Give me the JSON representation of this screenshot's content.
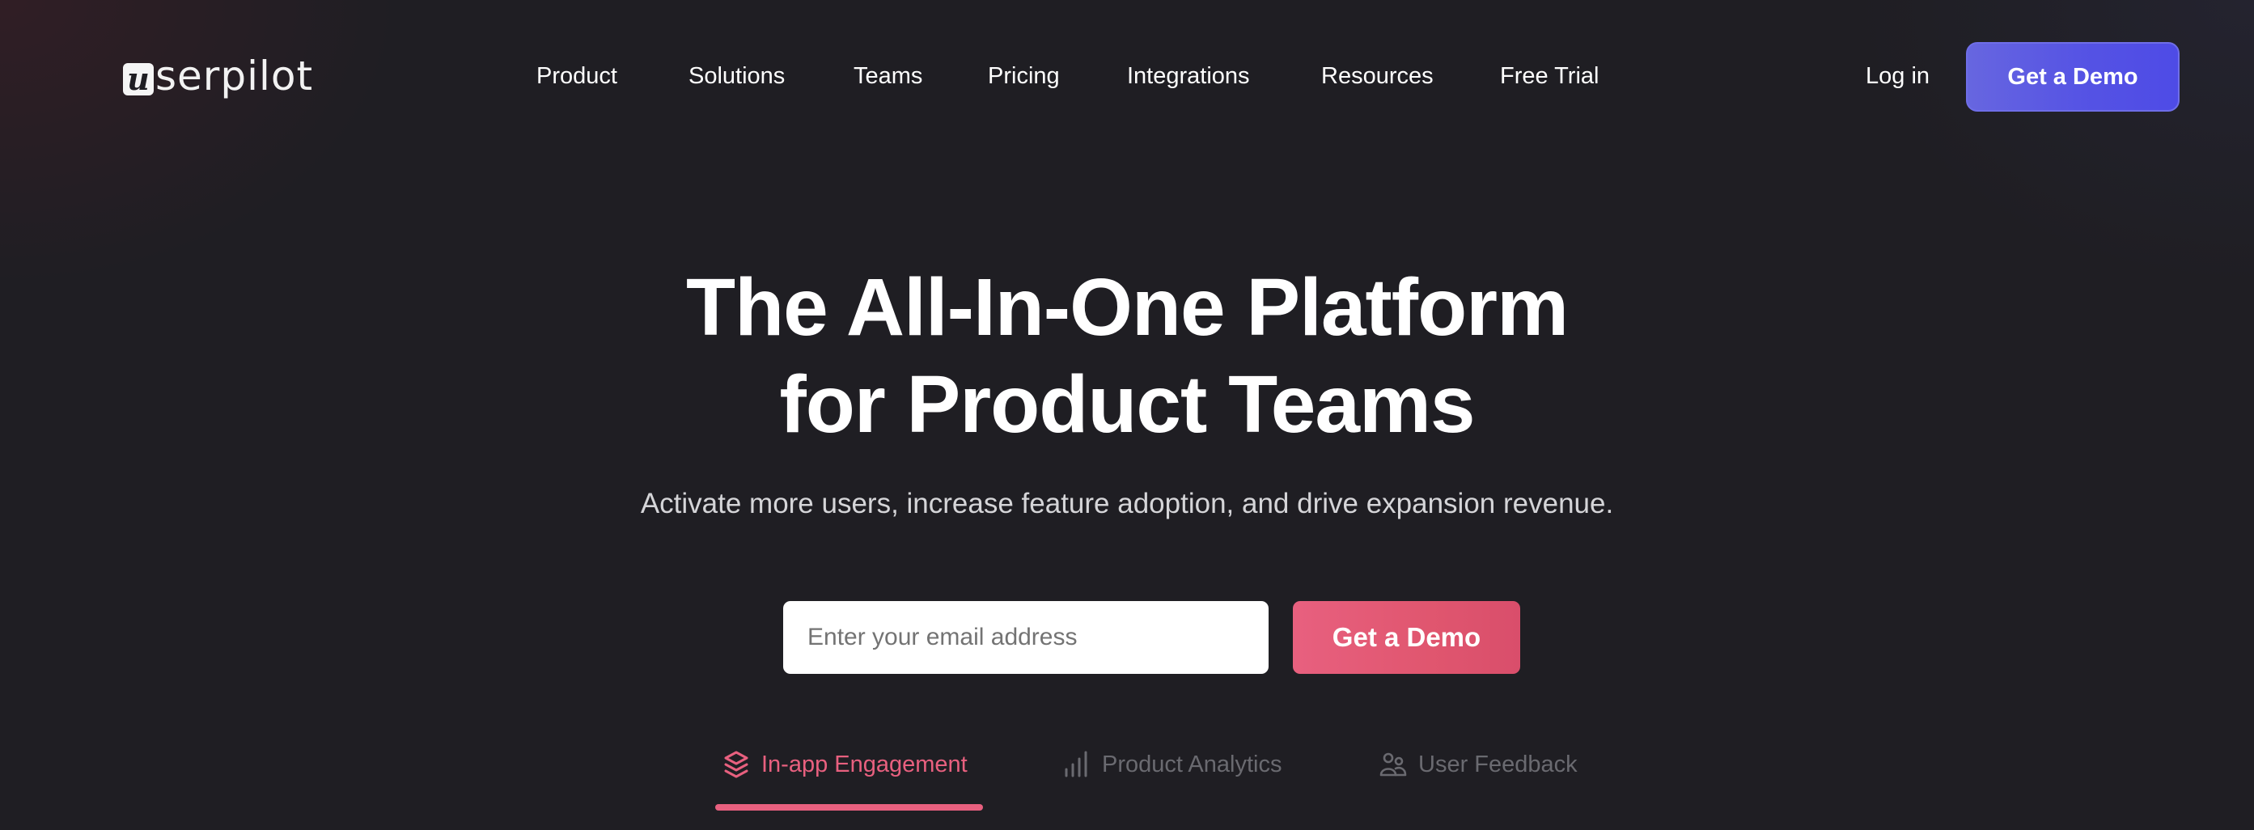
{
  "header": {
    "logo": {
      "badge_letter": "u",
      "text": "serpilot",
      "name": "userpilot"
    },
    "nav": [
      {
        "label": "Product"
      },
      {
        "label": "Solutions"
      },
      {
        "label": "Teams"
      },
      {
        "label": "Pricing"
      },
      {
        "label": "Integrations"
      },
      {
        "label": "Resources"
      },
      {
        "label": "Free Trial"
      }
    ],
    "login_label": "Log in",
    "cta_label": "Get a Demo"
  },
  "hero": {
    "title_line1": "The All-In-One Platform",
    "title_line2": "for Product Teams",
    "subtitle": "Activate more users, increase feature adoption, and drive expansion revenue.",
    "email_placeholder": "Enter your email address",
    "email_value": "",
    "cta_label": "Get a Demo"
  },
  "tabs": [
    {
      "label": "In-app Engagement",
      "icon": "layers-icon",
      "active": true
    },
    {
      "label": "Product Analytics",
      "icon": "bar-chart-icon",
      "active": false
    },
    {
      "label": "User Feedback",
      "icon": "users-icon",
      "active": false
    }
  ],
  "colors": {
    "background": "#1f1e23",
    "primary_purple": "#5553e4",
    "accent_pink": "#e8607f",
    "inactive_tab": "#6a6a70"
  }
}
